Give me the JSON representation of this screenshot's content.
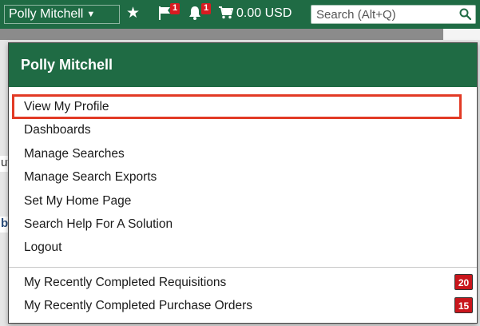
{
  "colors": {
    "brand_green": "#1f6b44",
    "badge_red": "#d81b21",
    "highlight_outline": "#e23a25"
  },
  "header": {
    "user_name": "Polly Mitchell",
    "favorites_icon": "star-icon",
    "flag_icon": "flag-icon",
    "flag_count": "1",
    "notifications_icon": "bell-icon",
    "notifications_count": "1",
    "cart_icon": "cart-icon",
    "cart_total": "0.00 USD",
    "search_placeholder": "Search (Alt+Q)",
    "search_icon": "search-icon"
  },
  "background_page": {
    "fragment_1": "ut",
    "fragment_2": "b"
  },
  "user_dropdown": {
    "title": "Polly Mitchell",
    "items": [
      {
        "label": "View My Profile",
        "highlighted": true
      },
      {
        "label": "Dashboards"
      },
      {
        "label": "Manage Searches"
      },
      {
        "label": "Manage Search Exports"
      },
      {
        "label": "Set My Home Page"
      },
      {
        "label": "Search Help For A Solution"
      },
      {
        "label": "Logout"
      }
    ],
    "recent": [
      {
        "label": "My Recently Completed Requisitions",
        "count": "20"
      },
      {
        "label": "My Recently Completed Purchase Orders",
        "count": "15"
      }
    ]
  }
}
